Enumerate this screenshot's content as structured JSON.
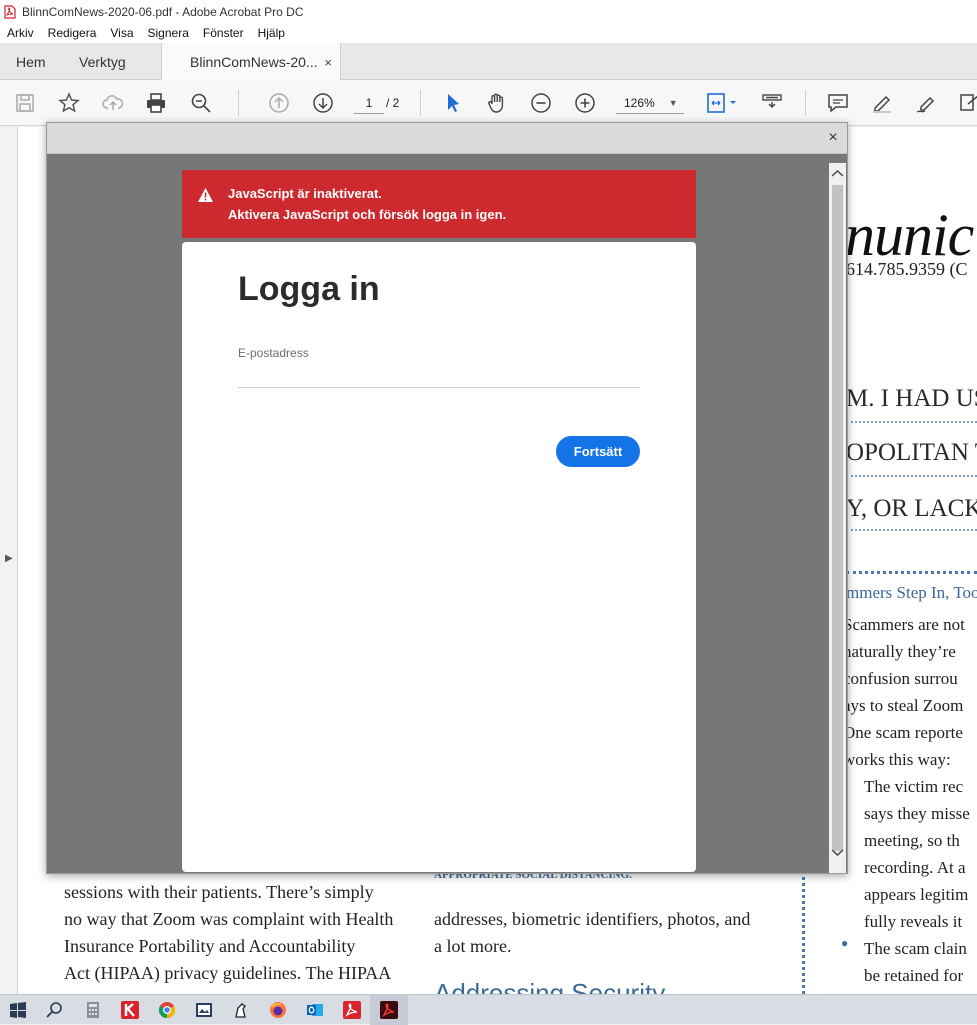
{
  "window": {
    "title": "BlinnComNews-2020-06.pdf - Adobe Acrobat Pro DC"
  },
  "menu": [
    "Arkiv",
    "Redigera",
    "Visa",
    "Signera",
    "Fönster",
    "Hjälp"
  ],
  "tabs": {
    "home": "Hem",
    "tools": "Verktyg",
    "document": "BlinnComNews-20...",
    "close_glyph": "×"
  },
  "toolbar": {
    "page_current": "1",
    "page_total": "/ 2",
    "zoom": "126%"
  },
  "document": {
    "masthead": "nunic",
    "phone": "614.785.9359 (C",
    "heading1": "M. I HAD USE",
    "heading2": "OPOLITAN TE",
    "heading3": "Y, OR LACK O",
    "section_title": "mmers Step In, Too",
    "right_col": [
      "Scammers are not",
      "naturally they’re",
      "confusion surrou",
      "ays to steal Zoom",
      "One scam reporte",
      "works this way:"
    ],
    "bullet1": [
      "The victim rec",
      "says they misse",
      "meeting, so th",
      "recording. At a",
      "appears legitim",
      "fully reveals it"
    ],
    "bullet2": [
      "The scam clain",
      "be retained for"
    ],
    "left_col": [
      "sessions with their patients. There’s simply",
      "no way that Zoom was complaint with Health",
      "Insurance Portability and Accountability",
      "Act (HIPAA) privacy guidelines. The HIPAA"
    ],
    "mid_caption": "APPROPRIATE SOCIAL DISTANCING.",
    "mid_col": [
      "addresses, biometric identifiers, photos, and",
      "a lot more."
    ],
    "mid_heading": "Addressing Security"
  },
  "dialog": {
    "close_glyph": "×",
    "alert_line1": "JavaScript är inaktiverat.",
    "alert_line2": "Aktivera JavaScript och försök logga in igen.",
    "title": "Logga in",
    "email_label": "E-postadress",
    "email_value": "",
    "continue_label": "Fortsätt"
  },
  "colors": {
    "alert_red": "#cc2a2f",
    "primary_blue": "#1473e6",
    "heading_blue": "#3d6a99"
  },
  "taskbar": [
    "start-icon",
    "search-icon",
    "calculator-icon",
    "k-app-icon",
    "chrome-icon",
    "app-icon",
    "app-icon",
    "firefox-icon",
    "outlook-icon",
    "acrobat-reader-icon",
    "acrobat-pro-icon"
  ]
}
